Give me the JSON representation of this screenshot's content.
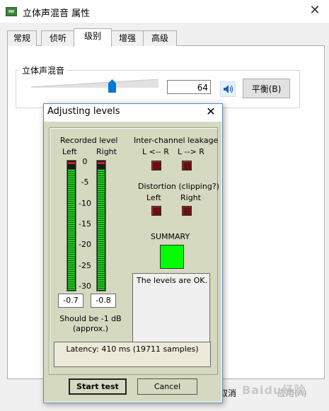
{
  "window": {
    "title": "立体声混音 属性",
    "tabs": [
      "常规",
      "侦听",
      "级别",
      "增强",
      "高级"
    ],
    "active_tab": "级别",
    "group_label": "立体声混音",
    "level_value": "64",
    "balance_label": "平衡(B)",
    "cancel_label": "取消",
    "apply_label": "应用(A)",
    "watermark": "Baidu经验"
  },
  "dialog": {
    "title": "Adjusting levels",
    "recorded_level": "Recorded level",
    "left": "Left",
    "right": "Right",
    "scale": [
      "0",
      "-5",
      "-10",
      "-15",
      "-20",
      "-25",
      "-30"
    ],
    "left_reading": "-0.7",
    "right_reading": "-0.8",
    "left_level_fraction": 0.97,
    "right_level_fraction": 0.97,
    "should_be": "Should be  -1 dB",
    "approx": "(approx.)",
    "leakage_title": "Inter-channel leakage",
    "leakage_l_to_r": "L <-- R",
    "leakage_r_to_l": "L --> R",
    "distortion_title": "Distortion (clipping?)",
    "distortion_left": "Left",
    "distortion_right": "Right",
    "summary": "SUMMARY",
    "status": "The levels are OK.",
    "latency": "Latency: 410 ms (19711 samples)",
    "start_test": "Start test",
    "cancel": "Cancel"
  },
  "colors": {
    "summary_ok": "#00ff00",
    "led_off": "#6b1010",
    "meter_green": "#22cc22",
    "accent": "#0078d7"
  }
}
